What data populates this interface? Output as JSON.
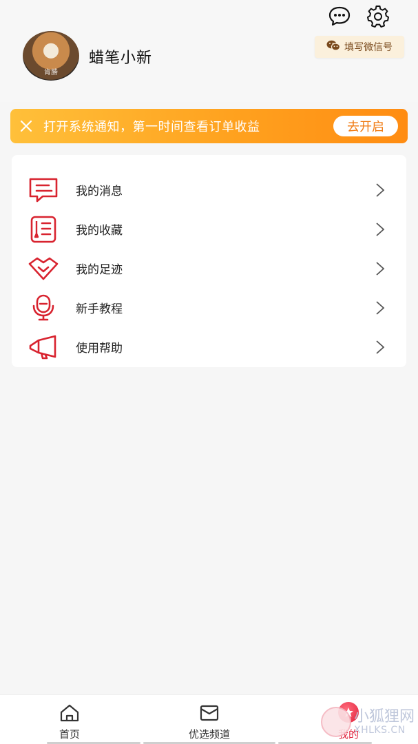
{
  "profile": {
    "username": "蜡笔小新",
    "avatar_caption": "肯勝"
  },
  "header": {
    "wechat_label": "填写微信号",
    "icons": [
      "chat-icon",
      "gear-icon",
      "wechat-icon"
    ]
  },
  "banner": {
    "text": "打开系统通知，第一时间查看订单收益",
    "button_label": "去开启",
    "colors": {
      "start": "#ffc03a",
      "end": "#ff8c12",
      "button_text": "#f07a12"
    }
  },
  "menu": {
    "items": [
      {
        "label": "我的消息",
        "icon": "message-icon"
      },
      {
        "label": "我的收藏",
        "icon": "favorites-icon"
      },
      {
        "label": "我的足迹",
        "icon": "footprint-icon"
      },
      {
        "label": "新手教程",
        "icon": "tutorial-icon"
      },
      {
        "label": "使用帮助",
        "icon": "help-icon"
      }
    ],
    "accent_color": "#d8232f"
  },
  "tabbar": {
    "tabs": [
      {
        "label": "首页",
        "icon": "home-icon"
      },
      {
        "label": "优选频道",
        "icon": "channel-icon"
      },
      {
        "label": "我的",
        "icon": "mine-icon"
      }
    ],
    "active_tab": "我的",
    "active_color": "#e0203a"
  },
  "watermark": {
    "title": "小狐狸网",
    "url": "XHLKS.CN"
  }
}
